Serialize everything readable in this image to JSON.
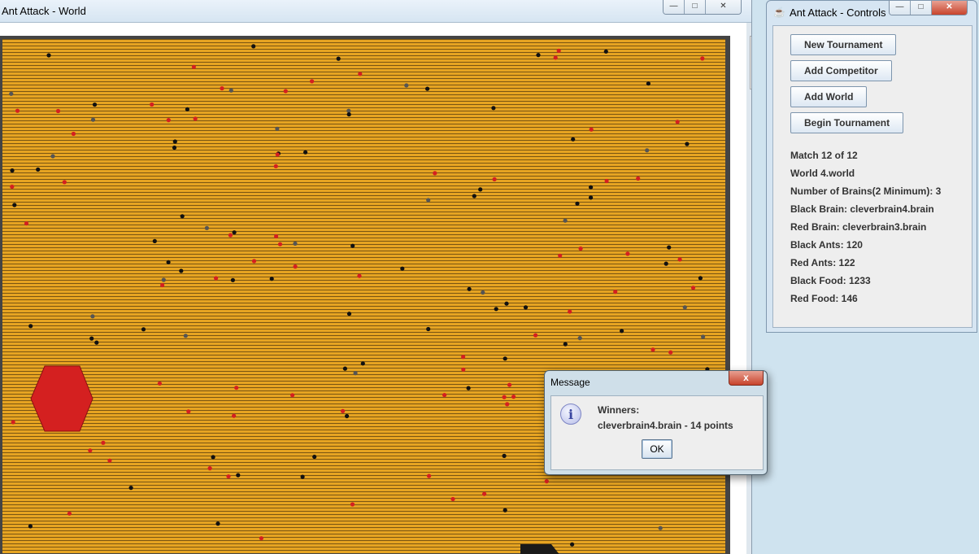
{
  "world_window": {
    "title": "Ant Attack - World"
  },
  "controls_window": {
    "title": "Ant Attack - Controls",
    "buttons": {
      "new_tournament": "New Tournament",
      "add_competitor": "Add Competitor",
      "add_world": "Add World",
      "begin_tournament": "Begin Tournament"
    },
    "info": {
      "match": "Match 12 of 12",
      "world": "World 4.world",
      "num_brains": "Number of Brains(2 Minimum): 3",
      "black_brain": "Black Brain: cleverbrain4.brain",
      "red_brain": "Red Brain: cleverbrain3.brain",
      "black_ants": "Black Ants: 120",
      "red_ants": "Red Ants: 122",
      "black_food": "Black Food: 1233",
      "red_food": "Red Food: 146"
    }
  },
  "dialog": {
    "title": "Message",
    "close_label": "x",
    "line1": "Winners:",
    "line2": "cleverbrain4.brain - 14 points",
    "ok_label": "OK",
    "icon": "info-icon"
  },
  "colors": {
    "terrain": "#e6a422",
    "red_ant": "#d42020",
    "black_ant": "#111111",
    "rock": "#444444"
  },
  "icons": {
    "minimize": "minimize-icon",
    "maximize": "maximize-icon",
    "close": "close-icon",
    "java": "java-icon"
  }
}
